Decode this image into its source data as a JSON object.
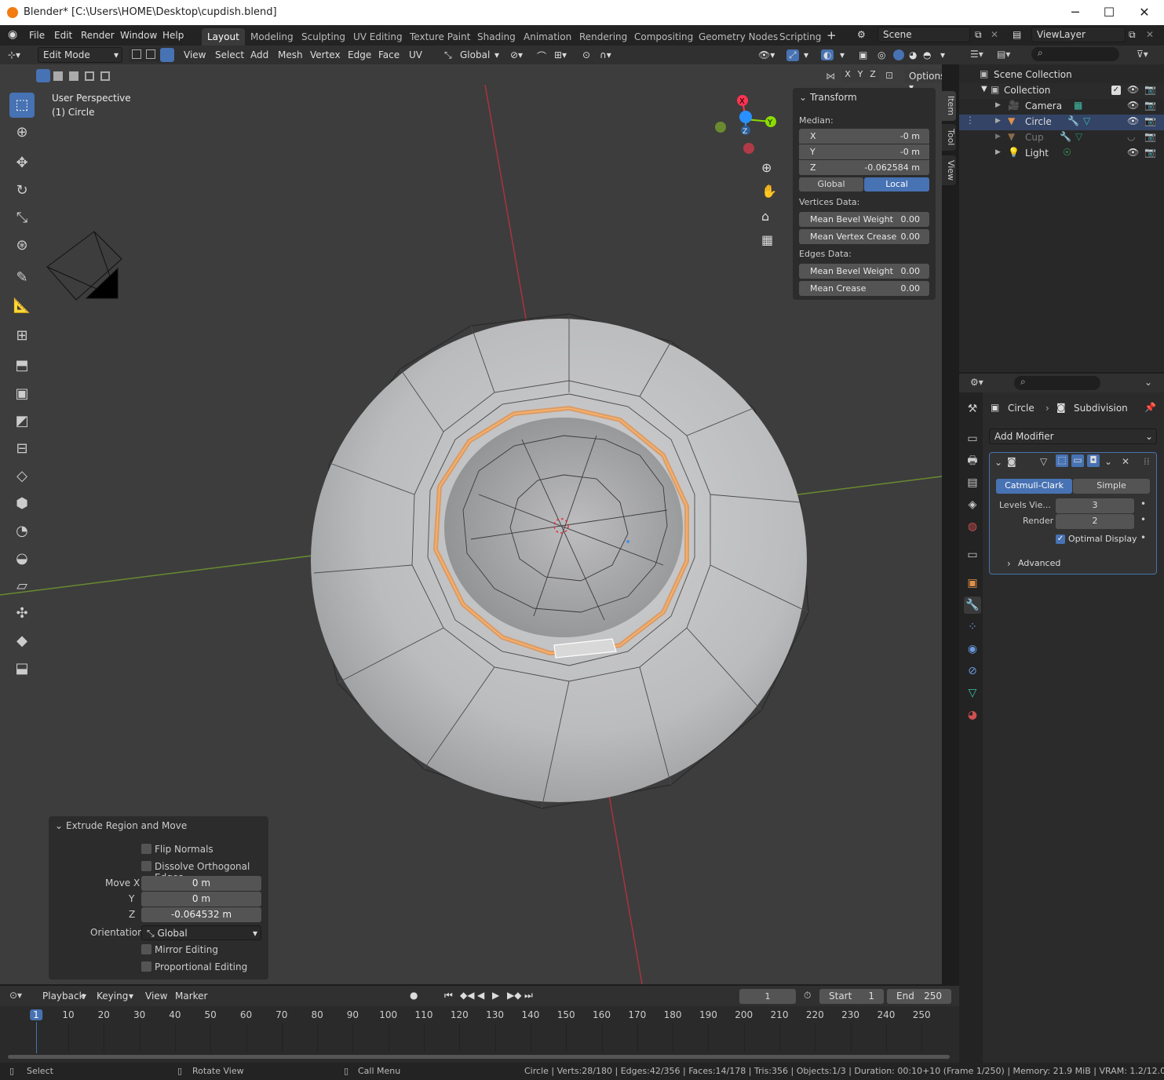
{
  "window": {
    "title": "Blender* [C:\\Users\\HOME\\Desktop\\cupdish.blend]",
    "minimize": "─",
    "maximize": "☐",
    "close": "✕"
  },
  "menus": [
    "File",
    "Edit",
    "Render",
    "Window",
    "Help"
  ],
  "workspaces": [
    "Layout",
    "Modeling",
    "Sculpting",
    "UV Editing",
    "Texture Paint",
    "Shading",
    "Animation",
    "Rendering",
    "Compositing",
    "Geometry Nodes",
    "Scripting"
  ],
  "scene": {
    "name": "Scene",
    "view_layer": "ViewLayer"
  },
  "viewport_header": {
    "mode": "Edit Mode",
    "menus": [
      "View",
      "Select",
      "Add",
      "Mesh",
      "Vertex",
      "Edge",
      "Face",
      "UV"
    ],
    "orientation": "Global",
    "options": "Options",
    "axes": [
      "X",
      "Y",
      "Z"
    ]
  },
  "viewport": {
    "perspective": "User Perspective",
    "object": "(1) Circle",
    "gizmo": {
      "x": "X",
      "y": "Y",
      "z": "Z"
    }
  },
  "side_tabs": [
    "Item",
    "Tool",
    "View"
  ],
  "transform": {
    "title": "Transform",
    "median_label": "Median:",
    "x": {
      "label": "X",
      "value": "-0 m"
    },
    "y": {
      "label": "Y",
      "value": "-0 m"
    },
    "z": {
      "label": "Z",
      "value": "-0.062584 m"
    },
    "space_global": "Global",
    "space_local": "Local",
    "vertices_data": "Vertices Data:",
    "v_bevel": {
      "label": "Mean Bevel Weight",
      "value": "0.00"
    },
    "v_crease": {
      "label": "Mean Vertex Crease",
      "value": "0.00"
    },
    "edges_data": "Edges Data:",
    "e_bevel": {
      "label": "Mean Bevel Weight",
      "value": "0.00"
    },
    "e_crease": {
      "label": "Mean Crease",
      "value": "0.00"
    }
  },
  "outliner": {
    "root": "Scene Collection",
    "collection": "Collection",
    "items": [
      {
        "name": "Camera",
        "color": "#dcdcdc"
      },
      {
        "name": "Circle",
        "color": "#dcdcdc"
      },
      {
        "name": "Cup",
        "color": "#7a7a7a"
      },
      {
        "name": "Light",
        "color": "#dcdcdc"
      }
    ]
  },
  "properties": {
    "breadcrumb_object": "Circle",
    "breadcrumb_modifier": "Subdivision",
    "add_modifier": "Add Modifier",
    "catmull": "Catmull-Clark",
    "simple": "Simple",
    "levels_label": "Levels Vie...",
    "levels_value": "3",
    "render_label": "Render",
    "render_value": "2",
    "optimal": "Optimal Display",
    "advanced": "Advanced"
  },
  "redo_panel": {
    "title": "Extrude Region and Move",
    "flip_normals": "Flip Normals",
    "dissolve": "Dissolve Orthogonal Edges",
    "move_x_label": "Move X",
    "move_y_label": "Y",
    "move_z_label": "Z",
    "move_x": "0 m",
    "move_y": "0 m",
    "move_z": "-0.064532 m",
    "orientation_label": "Orientation",
    "orientation": "Global",
    "mirror": "Mirror Editing",
    "proportional": "Proportional Editing"
  },
  "timeline": {
    "menus": [
      "Playback",
      "Keying",
      "View",
      "Marker"
    ],
    "current_frame": "1",
    "start_label": "Start",
    "start": "1",
    "end_label": "End",
    "end": "250",
    "ticks": [
      "1",
      "10",
      "20",
      "30",
      "40",
      "50",
      "60",
      "70",
      "80",
      "90",
      "100",
      "110",
      "120",
      "130",
      "140",
      "150",
      "160",
      "170",
      "180",
      "190",
      "200",
      "210",
      "220",
      "230",
      "240",
      "250"
    ]
  },
  "statusbar": {
    "select": "Select",
    "rotate": "Rotate View",
    "call_menu": "Call Menu",
    "stats": "Circle | Verts:28/180 | Edges:42/356 | Faces:14/178 | Tris:356 | Objects:1/3 | Duration: 00:10+10 (Frame 1/250) | Memory: 21.9 MiB | VRAM: 1.2/12.0 GiB | 3.6.1"
  },
  "colors": {
    "accent": "#4772b3",
    "selection": "#e0904a",
    "x_axis": "#ff3352",
    "y_axis": "#8bdc00",
    "z_axis": "#2890ff"
  }
}
